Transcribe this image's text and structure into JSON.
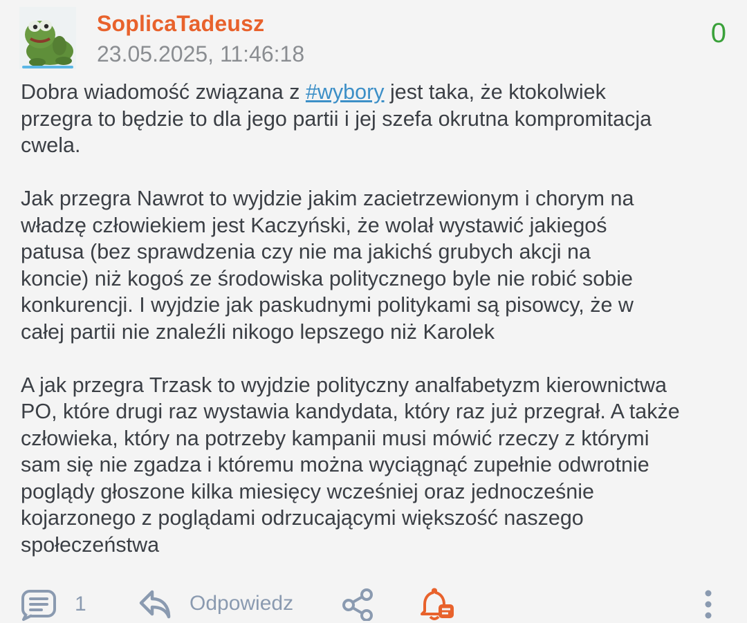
{
  "post": {
    "author": "SoplicaTadeusz",
    "timestamp": "23.05.2025, 11:46:18",
    "score": "0",
    "paragraphs": {
      "p1_before": "Dobra wiadomość związana z ",
      "p1_tag": "#wybory",
      "p1_after": " jest taka, że ktokolwiek\nprzegra to będzie to dla jego partii i jej szefa okrutna kompromitacja\ncwela.",
      "p2": "Jak przegra Nawrot to wyjdzie jakim zacietrzewionym i chorym na\nwładzę człowiekiem jest Kaczyński, że wolał wystawić jakiegoś\npatusa (bez sprawdzenia czy nie ma jakichś grubych akcji na\nkoncie) niż kogoś ze środowiska politycznego byle nie robić sobie\nkonkurencji. I wyjdzie jak paskudnymi politykami są pisowcy, że w\ncałej partii nie znaleźli nikogo lepszego niż Karolek",
      "p3": "A jak przegra Trzask to wyjdzie polityczny analfabetyzm kierownictwa\nPO, które drugi raz wystawia kandydata, który raz już przegrał. A także\nczłowieka, który na potrzeby kampanii musi mówić rzeczy z którymi\nsam się nie zgadza i któremu można wyciągnąć zupełnie odwrotnie\npoglądy głoszone kilka miesięcy wcześniej oraz jednocześnie\nkojarzonego z poglądami odrzucającymi większość naszego\nspołeczeństwa"
    }
  },
  "actions": {
    "comments_count": "1",
    "reply_label": "Odpowiedz"
  },
  "colors": {
    "author": "#e8622c",
    "score": "#3aa13a",
    "tag": "#3c8fc7",
    "action_icon": "#8a9ab0",
    "notify_icon": "#e8622c"
  },
  "icons": [
    "avatar-image",
    "comment-icon",
    "reply-icon",
    "share-icon",
    "notification-bell-icon",
    "more-vertical-icon"
  ]
}
